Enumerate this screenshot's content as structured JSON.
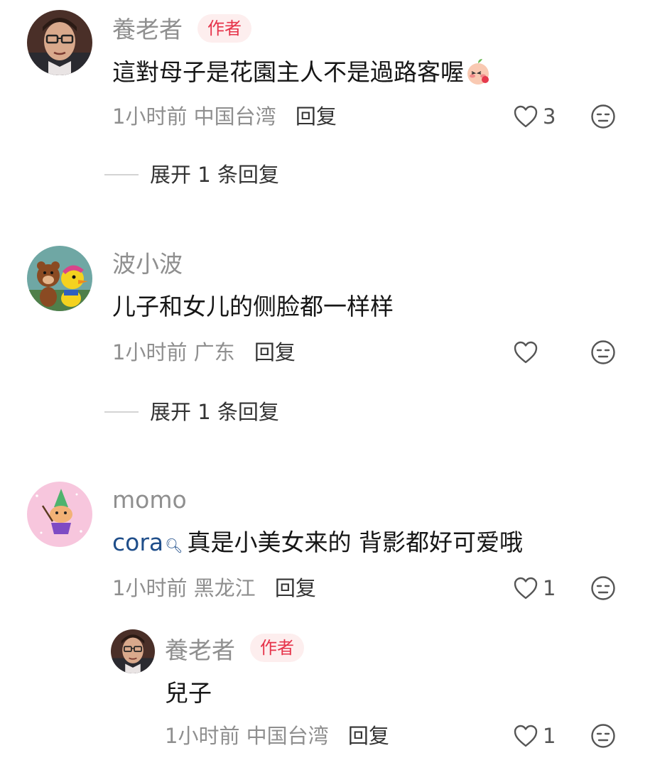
{
  "comments": [
    {
      "username": "養老者",
      "badge": "作者",
      "text": "這對母子是花園主人不是過路客喔",
      "emoji_icon": "peach-shy-emoji-icon",
      "time": "1小时前",
      "location": "中国台湾",
      "reply_label": "回复",
      "likes": "3",
      "expand_label": "展开 1 条回复"
    },
    {
      "username": "波小波",
      "text": "儿子和女儿的侧脸都一样样",
      "time": "1小时前",
      "location": "广东",
      "reply_label": "回复",
      "likes": "",
      "expand_label": "展开 1 条回复"
    },
    {
      "username": "momo",
      "mention": "cora",
      "mention_icon": "search-icon",
      "text": "真是小美女来的 背影都好可爱哦",
      "time": "1小时前",
      "location": "黑龙江",
      "reply_label": "回复",
      "likes": "1"
    }
  ],
  "reply": {
    "username": "養老者",
    "badge": "作者",
    "text": "兒子",
    "time": "1小时前",
    "location": "中国台湾",
    "reply_label": "回复",
    "likes": "1"
  },
  "colors": {
    "badge_bg": "#fdeeee",
    "badge_text": "#e6334a",
    "mention": "#1f4e8a",
    "meta": "#8f8f8f"
  }
}
